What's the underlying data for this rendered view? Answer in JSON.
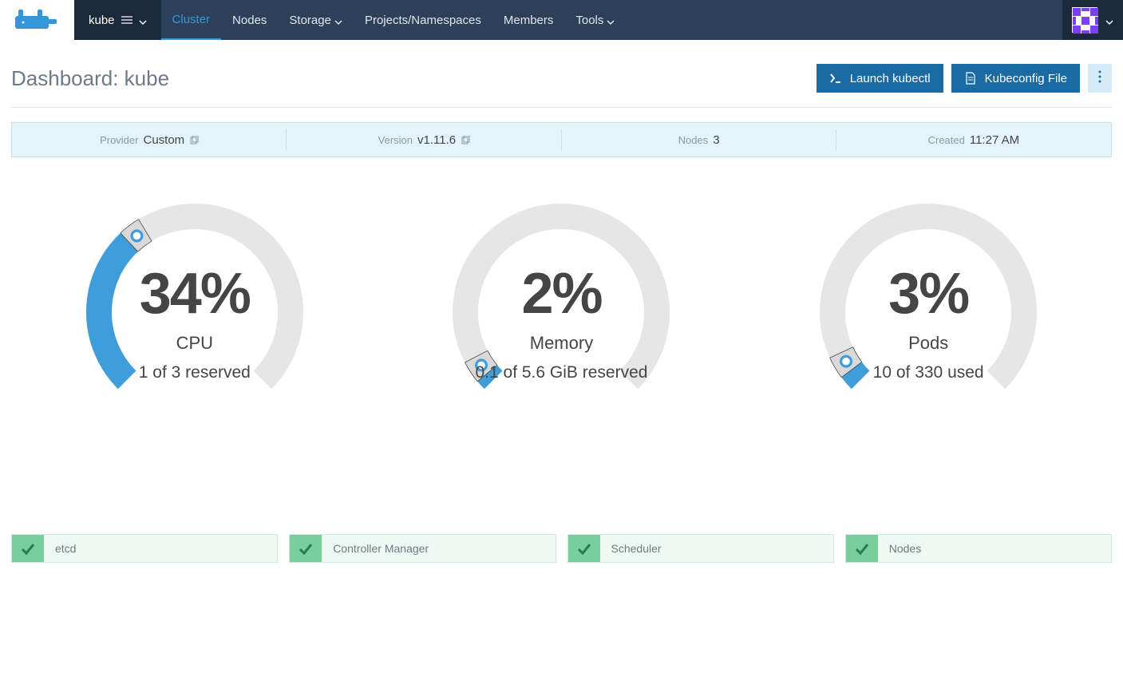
{
  "nav": {
    "cluster_name": "kube",
    "items": [
      {
        "label": "Cluster",
        "active": true,
        "dropdown": false
      },
      {
        "label": "Nodes",
        "active": false,
        "dropdown": false
      },
      {
        "label": "Storage",
        "active": false,
        "dropdown": true
      },
      {
        "label": "Projects/Namespaces",
        "active": false,
        "dropdown": false
      },
      {
        "label": "Members",
        "active": false,
        "dropdown": false
      },
      {
        "label": "Tools",
        "active": false,
        "dropdown": true
      }
    ]
  },
  "header": {
    "title_prefix": "Dashboard: ",
    "title_name": "kube",
    "launch_kubectl": "Launch kubectl",
    "kubeconfig_file": "Kubeconfig File"
  },
  "banner": {
    "provider_label": "Provider",
    "provider_value": "Custom",
    "version_label": "Version",
    "version_value": "v1.11.6",
    "nodes_label": "Nodes",
    "nodes_value": "3",
    "created_label": "Created",
    "created_value": "11:27 AM"
  },
  "gauges": [
    {
      "percent": "34%",
      "title": "CPU",
      "sub": "1 of 3 reserved",
      "value": 34
    },
    {
      "percent": "2%",
      "title": "Memory",
      "sub": "0.1 of 5.6 GiB reserved",
      "value": 2
    },
    {
      "percent": "3%",
      "title": "Pods",
      "sub": "10 of 330 used",
      "value": 3
    }
  ],
  "components": [
    {
      "label": "etcd"
    },
    {
      "label": "Controller Manager"
    },
    {
      "label": "Scheduler"
    },
    {
      "label": "Nodes"
    }
  ],
  "chart_data": [
    {
      "type": "gauge",
      "title": "CPU",
      "value": 34,
      "unit": "%",
      "sub": "1 of 3 reserved",
      "range": [
        0,
        100
      ]
    },
    {
      "type": "gauge",
      "title": "Memory",
      "value": 2,
      "unit": "%",
      "sub": "0.1 of 5.6 GiB reserved",
      "range": [
        0,
        100
      ]
    },
    {
      "type": "gauge",
      "title": "Pods",
      "value": 3,
      "unit": "%",
      "sub": "10 of 330 used",
      "range": [
        0,
        100
      ]
    }
  ]
}
